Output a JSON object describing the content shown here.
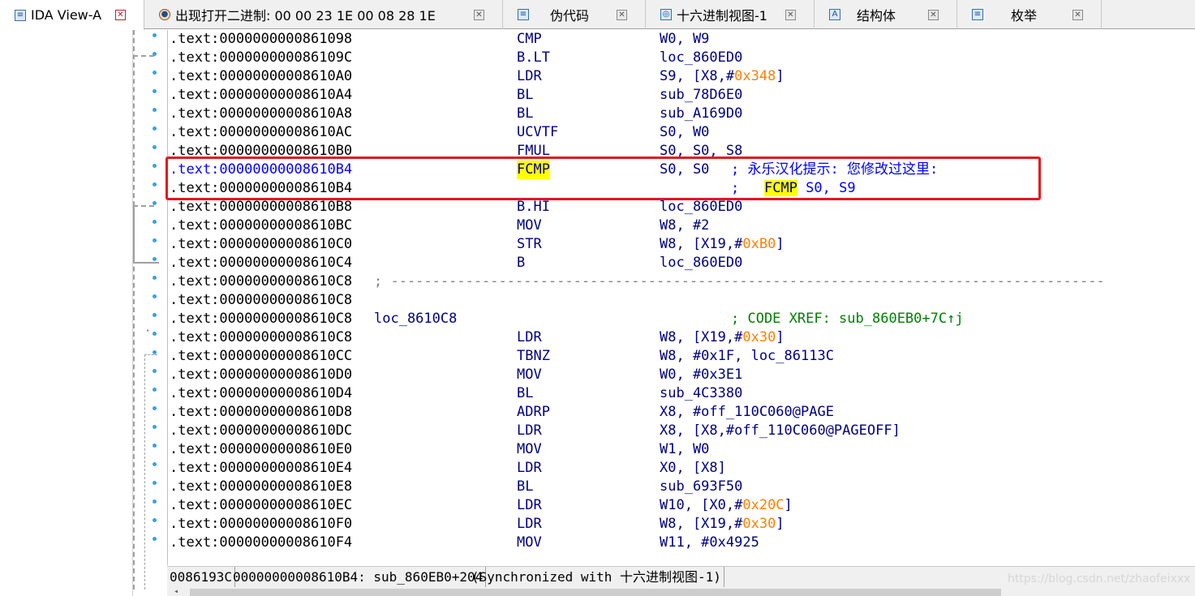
{
  "tabs": [
    {
      "label": "IDA View-A",
      "icon": "ida-view-icon"
    },
    {
      "label": "出现打开二进制: 00 00 23 1E 00 08 28 1E",
      "icon": "binary-icon"
    },
    {
      "label": "伪代码",
      "icon": "pseudocode-icon"
    },
    {
      "label": "十六进制视图-1",
      "icon": "hex-view-icon"
    },
    {
      "label": "结构体",
      "icon": "structures-icon"
    },
    {
      "label": "枚举",
      "icon": "enums-icon"
    }
  ],
  "lines": [
    {
      "addr": ".text:0000000000861098",
      "mn": "CMP",
      "ops": [
        "W0, W9"
      ]
    },
    {
      "addr": ".text:000000000086109C",
      "mn": "B.LT",
      "ops": [
        "loc_860ED0"
      ]
    },
    {
      "addr": ".text:00000000008610A0",
      "mn": "LDR",
      "ops": [
        "S9, [X8,#",
        "0x348",
        "]"
      ]
    },
    {
      "addr": ".text:00000000008610A4",
      "mn": "BL",
      "ops": [
        "sub_78D6E0"
      ]
    },
    {
      "addr": ".text:00000000008610A8",
      "mn": "BL",
      "ops": [
        "sub_A169D0"
      ]
    },
    {
      "addr": ".text:00000000008610AC",
      "mn": "UCVTF",
      "ops": [
        "S0, W0"
      ]
    },
    {
      "addr": ".text:00000000008610B0",
      "mn": "FMUL",
      "ops": [
        "S0, S0, S8"
      ]
    },
    {
      "addr": ".text:00000000008610B4",
      "mn": "FCMP",
      "ops": [
        "S0, S0"
      ],
      "comment": "; 永乐汉化提示: 您修改过这里:"
    },
    {
      "addr": ".text:00000000008610B4",
      "comment_pre": ";   ",
      "comment_hl": "FCMP",
      "comment_post": " S0, S9"
    },
    {
      "addr": ".text:00000000008610B8",
      "mn": "B.HI",
      "ops": [
        "loc_860ED0"
      ]
    },
    {
      "addr": ".text:00000000008610BC",
      "mn": "MOV",
      "ops": [
        "W8, #2"
      ]
    },
    {
      "addr": ".text:00000000008610C0",
      "mn": "STR",
      "ops": [
        "W8, [X19,#",
        "0xB0",
        "]"
      ]
    },
    {
      "addr": ".text:00000000008610C4",
      "mn": "B",
      "ops": [
        "loc_860ED0"
      ]
    },
    {
      "addr": ".text:00000000008610C8",
      "sep": "; --------------------------------------------------------------------------------------"
    },
    {
      "addr": ".text:00000000008610C8"
    },
    {
      "addr": ".text:00000000008610C8",
      "label": "loc_8610C8",
      "comment": "; CODE XREF: sub_860EB0+7C↑j"
    },
    {
      "addr": ".text:00000000008610C8",
      "mn": "LDR",
      "ops": [
        "W8, [X19,#",
        "0x30",
        "]"
      ]
    },
    {
      "addr": ".text:00000000008610CC",
      "mn": "TBNZ",
      "ops": [
        "W8, #0x1F, loc_86113C"
      ]
    },
    {
      "addr": ".text:00000000008610D0",
      "mn": "MOV",
      "ops": [
        "W0, #0x3E1"
      ]
    },
    {
      "addr": ".text:00000000008610D4",
      "mn": "BL",
      "ops": [
        "sub_4C3380"
      ]
    },
    {
      "addr": ".text:00000000008610D8",
      "mn": "ADRP",
      "ops": [
        "X8, #off_110C060@PAGE"
      ]
    },
    {
      "addr": ".text:00000000008610DC",
      "mn": "LDR",
      "ops": [
        "X8, [X8,#off_110C060@PAGEOFF]"
      ]
    },
    {
      "addr": ".text:00000000008610E0",
      "mn": "MOV",
      "ops": [
        "W1, W0"
      ]
    },
    {
      "addr": ".text:00000000008610E4",
      "mn": "LDR",
      "ops": [
        "X0, [X8]"
      ]
    },
    {
      "addr": ".text:00000000008610E8",
      "mn": "BL",
      "ops": [
        "sub_693F50"
      ]
    },
    {
      "addr": ".text:00000000008610EC",
      "mn": "LDR",
      "ops": [
        "W10, [X0,#",
        "0x20C",
        "]"
      ]
    },
    {
      "addr": ".text:00000000008610F0",
      "mn": "LDR",
      "ops": [
        "W8, [X19,#",
        "0x30",
        "]"
      ]
    },
    {
      "addr": ".text:00000000008610F4",
      "mn": "MOV",
      "ops": [
        "W11, #0x4925"
      ]
    }
  ],
  "status": {
    "offset": "0086193C",
    "location": "00000000008610B4: sub_860EB0+204",
    "sync": "(Synchronized with 十六进制视图-1)"
  },
  "watermark": "https://blog.csdn.net/zhaofeixxx",
  "colors": {
    "highlight": "#ffff00",
    "redbox": "#e8141b",
    "immediate": "#ff8000",
    "comment": "#008000",
    "current_address": "#0000ff"
  }
}
